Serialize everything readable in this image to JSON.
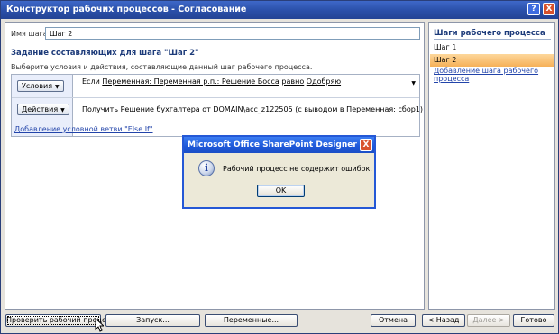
{
  "window": {
    "title": "Конструктор рабочих процессов - Согласование",
    "help_glyph": "?",
    "close_glyph": "X"
  },
  "step": {
    "name_label": "Имя шага:",
    "name_value": "Шаг 2"
  },
  "section": {
    "title": "Задание составляющих для шага \"Шаг 2\"",
    "instruction": "Выберите условия и действия, составляющие данный шаг рабочего процесса."
  },
  "conditions": {
    "button_label": "Условия",
    "text_prefix": "Если",
    "field": "Переменная: Переменная р.п.: Решение Босса",
    "operator": "равно",
    "value": "Одобряю"
  },
  "actions": {
    "button_label": "Действия",
    "text_prefix": "Получить",
    "item": "Решение бухгалтера",
    "from_word": "от",
    "user": "DOMAIN\\acc_z122505",
    "output_text": "(с выводом в",
    "output_var": "Переменная: сбор1",
    "close_paren": ")"
  },
  "else_if_link": "Добавление условной ветви \"Else If\"",
  "sidebar": {
    "title": "Шаги рабочего процесса",
    "steps": [
      "Шаг 1",
      "Шаг 2"
    ],
    "selected_index": 1,
    "add_link": "Добавление шага рабочего процесса"
  },
  "bottom": {
    "check_label": "Проверить рабочий процесс",
    "launch_label": "Запуск...",
    "variables_label": "Переменные...",
    "cancel_label": "Отмена",
    "back_label": "< Назад",
    "next_label": "Далее >",
    "finish_label": "Готово"
  },
  "dialog": {
    "title": "Microsoft Office SharePoint Designer",
    "message": "Рабочий процесс не содержит ошибок.",
    "ok_label": "OK",
    "icon": "information-icon",
    "icon_glyph": "i",
    "close_glyph": "X"
  },
  "colors": {
    "title_bar": "#2a4fa8",
    "selected_step": "#f6b058",
    "link": "#2244aa",
    "heading": "#1d3b7a"
  }
}
